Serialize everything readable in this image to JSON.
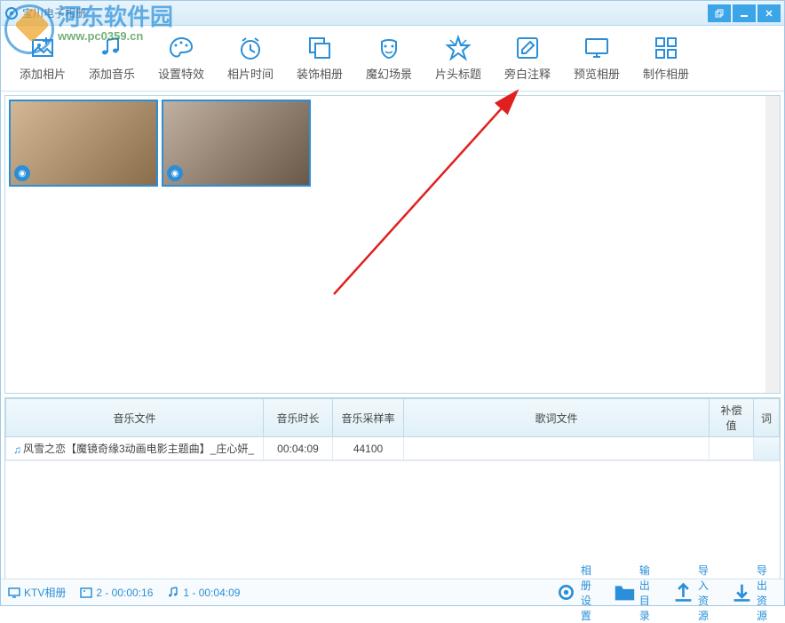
{
  "titlebar": {
    "title": "宝川电子相册"
  },
  "watermark": {
    "text": "河东软件园",
    "url": "www.pc0359.cn"
  },
  "toolbar": [
    {
      "id": "add-photo",
      "label": "添加相片",
      "icon": "photo"
    },
    {
      "id": "add-music",
      "label": "添加音乐",
      "icon": "music"
    },
    {
      "id": "set-effects",
      "label": "设置特效",
      "icon": "palette"
    },
    {
      "id": "photo-time",
      "label": "相片时间",
      "icon": "clock"
    },
    {
      "id": "decorate-album",
      "label": "装饰相册",
      "icon": "layers"
    },
    {
      "id": "magic-scene",
      "label": "魔幻场景",
      "icon": "mask"
    },
    {
      "id": "title-header",
      "label": "片头标题",
      "icon": "star"
    },
    {
      "id": "aside-note",
      "label": "旁白注释",
      "icon": "edit"
    },
    {
      "id": "preview-album",
      "label": "预览相册",
      "icon": "monitor"
    },
    {
      "id": "make-album",
      "label": "制作相册",
      "icon": "grid"
    }
  ],
  "thumbnails": [
    {
      "id": "thumb-1"
    },
    {
      "id": "thumb-2"
    }
  ],
  "music_table": {
    "headers": {
      "file": "音乐文件",
      "duration": "音乐时长",
      "rate": "音乐采样率",
      "lyric": "歌词文件",
      "comp": "补偿值",
      "lrc": "词"
    },
    "rows": [
      {
        "file": "风雪之恋【魔镜奇缘3动画电影主题曲】_庄心妍_",
        "duration": "00:04:09",
        "rate": "44100",
        "lyric": "",
        "comp": ""
      }
    ]
  },
  "statusbar": {
    "album_type": "KTV相册",
    "photo_count": "2 - 00:00:16",
    "music_count": "1 - 00:04:09",
    "actions": {
      "settings": "相册设置",
      "output_dir": "输出目录",
      "import": "导入资源",
      "export": "导出资源"
    }
  }
}
